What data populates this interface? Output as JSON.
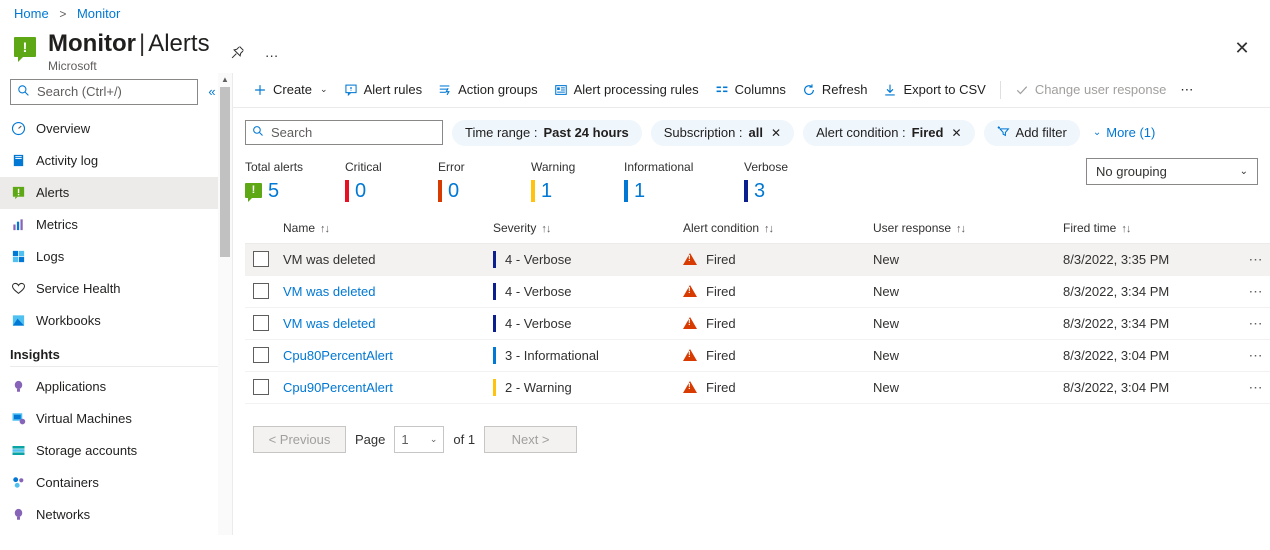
{
  "breadcrumb": {
    "home": "Home",
    "separator": ">",
    "current": "Monitor"
  },
  "header": {
    "icon": "alert-green-icon",
    "title": "Monitor",
    "divider": "|",
    "subpage": "Alerts",
    "subtitle": "Microsoft",
    "pin": "pin-icon",
    "ellipsis": "…",
    "close": "✕"
  },
  "sidebar": {
    "search_placeholder": "Search (Ctrl+/)",
    "search_value": "",
    "collapse": "«",
    "items": [
      {
        "label": "Overview",
        "icon": "gauge-icon",
        "selected": false
      },
      {
        "label": "Activity log",
        "icon": "book-icon",
        "selected": false
      },
      {
        "label": "Alerts",
        "icon": "alert-green-icon",
        "selected": true
      },
      {
        "label": "Metrics",
        "icon": "bar-chart-icon",
        "selected": false
      },
      {
        "label": "Logs",
        "icon": "logs-icon",
        "selected": false
      },
      {
        "label": "Service Health",
        "icon": "heart-icon",
        "selected": false
      },
      {
        "label": "Workbooks",
        "icon": "workbook-icon",
        "selected": false
      }
    ],
    "insights_title": "Insights",
    "insights_items": [
      {
        "label": "Applications",
        "icon": "lightbulb-purple-icon"
      },
      {
        "label": "Virtual Machines",
        "icon": "vm-icon"
      },
      {
        "label": "Storage accounts",
        "icon": "storage-icon"
      },
      {
        "label": "Containers",
        "icon": "containers-icon"
      },
      {
        "label": "Networks",
        "icon": "network-icon"
      }
    ]
  },
  "toolbar": {
    "create": "Create",
    "create_chevron": "⌄",
    "alert_rules": "Alert rules",
    "action_groups": "Action groups",
    "alert_processing_rules": "Alert processing rules",
    "columns": "Columns",
    "refresh": "Refresh",
    "export_csv": "Export to CSV",
    "change_user_response": "Change user response",
    "overflow": "⋯"
  },
  "filters": {
    "search_placeholder": "Search",
    "search_value": "",
    "pills": [
      {
        "label": "Time range :",
        "value": "Past 24 hours",
        "dismissable": false
      },
      {
        "label": "Subscription :",
        "value": "all",
        "dismissable": true
      },
      {
        "label": "Alert condition :",
        "value": "Fired",
        "dismissable": true
      }
    ],
    "add_filter": "Add filter",
    "more": "More (1)",
    "more_chevron": "⌄"
  },
  "summary": {
    "total": {
      "label": "Total alerts",
      "value": "5",
      "color": "#0078d4"
    },
    "severities": [
      {
        "label": "Critical",
        "value": "0",
        "color": "#e81123"
      },
      {
        "label": "Error",
        "value": "0",
        "color": "#d83b01"
      },
      {
        "label": "Warning",
        "value": "1",
        "color": "#ffc20e"
      },
      {
        "label": "Informational",
        "value": "1",
        "color": "#0078d4"
      },
      {
        "label": "Verbose",
        "value": "3",
        "color": "#0b1f8f"
      }
    ],
    "grouping": {
      "value": "No grouping",
      "chevron": "⌄"
    }
  },
  "table": {
    "columns": [
      {
        "label": "Name",
        "sort": "↑↓"
      },
      {
        "label": "Severity",
        "sort": "↑↓"
      },
      {
        "label": "Alert condition",
        "sort": "↑↓"
      },
      {
        "label": "User response",
        "sort": "↑↓"
      },
      {
        "label": "Fired time",
        "sort": "↑↓"
      }
    ],
    "row_menu": "⋯",
    "rows": [
      {
        "name": "VM was deleted",
        "name_style": "plain",
        "severity": "4 - Verbose",
        "severity_color": "#0b1f8f",
        "condition": "Fired",
        "user_response": "New",
        "fired_time": "8/3/2022, 3:35 PM",
        "hovered": true
      },
      {
        "name": "VM was deleted",
        "name_style": "link",
        "severity": "4 - Verbose",
        "severity_color": "#0b1f8f",
        "condition": "Fired",
        "user_response": "New",
        "fired_time": "8/3/2022, 3:34 PM",
        "hovered": false
      },
      {
        "name": "VM was deleted",
        "name_style": "link",
        "severity": "4 - Verbose",
        "severity_color": "#0b1f8f",
        "condition": "Fired",
        "user_response": "New",
        "fired_time": "8/3/2022, 3:34 PM",
        "hovered": false
      },
      {
        "name": "Cpu80PercentAlert",
        "name_style": "link",
        "severity": "3 - Informational",
        "severity_color": "#0078d4",
        "condition": "Fired",
        "user_response": "New",
        "fired_time": "8/3/2022, 3:04 PM",
        "hovered": false
      },
      {
        "name": "Cpu90PercentAlert",
        "name_style": "link",
        "severity": "2 - Warning",
        "severity_color": "#ffc20e",
        "condition": "Fired",
        "user_response": "New",
        "fired_time": "8/3/2022, 3:04 PM",
        "hovered": false
      }
    ]
  },
  "pagination": {
    "previous": "< Previous",
    "page_label": "Page",
    "page_value": "1",
    "page_chevron": "⌄",
    "of_label": "of 1",
    "next": "Next >"
  }
}
